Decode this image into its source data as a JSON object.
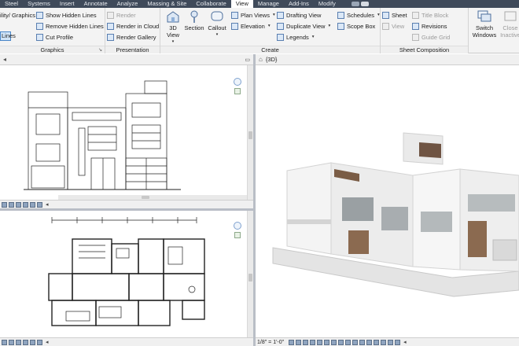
{
  "tabs": [
    {
      "label": "Steel"
    },
    {
      "label": "Systems"
    },
    {
      "label": "Insert"
    },
    {
      "label": "Annotate"
    },
    {
      "label": "Analyze"
    },
    {
      "label": "Massing & Site"
    },
    {
      "label": "Collaborate"
    },
    {
      "label": "View",
      "active": true
    },
    {
      "label": "Manage"
    },
    {
      "label": "Add-Ins"
    },
    {
      "label": "Modify"
    }
  ],
  "ribbon": {
    "graphics": {
      "visibility_label": "ility/ Graphics",
      "show_hidden_lines": "Show  Hidden Lines",
      "remove_hidden_lines": "Remove  Hidden Lines",
      "cut_profile": "Cut  Profile",
      "thin_lines": "Lines",
      "title": "Graphics"
    },
    "presentation": {
      "render": "Render",
      "render_cloud": "Render  in Cloud",
      "render_gallery": "Render  Gallery",
      "title": "Presentation"
    },
    "create": {
      "view_3d": "3D\nView",
      "section": "Section",
      "callout": "Callout",
      "plan_views": "Plan  Views",
      "elevation": "Elevation",
      "drafting_view": "Drafting  View",
      "duplicate_view": "Duplicate  View",
      "legends": "Legends",
      "schedules": "Schedules",
      "scope_box": "Scope  Box",
      "title": "Create"
    },
    "sheet_composition": {
      "sheet": "Sheet",
      "title_block": "Title  Block",
      "view": "View",
      "revisions": "Revisions",
      "guide_grid": "Guide  Grid",
      "title": "Sheet Composition"
    },
    "windows": {
      "switch_windows": "Switch\nWindows",
      "close_inactive": "Close\nInactive"
    }
  },
  "views": {
    "view3d_title": "{3D}",
    "view3d_scale": "1/8\" = 1'-0\""
  },
  "colors": {
    "tabbar_bg": "#3f4a5a",
    "accent": "#4a86c8",
    "splitter": "#b9bec6"
  }
}
